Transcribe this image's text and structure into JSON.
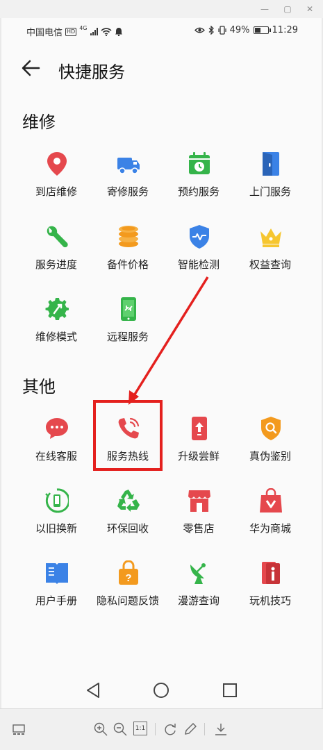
{
  "window": {
    "minimize_glyph": "—",
    "restore_glyph": "▢",
    "close_glyph": "✕"
  },
  "status_bar": {
    "carrier": "中国电信",
    "hd_badge": "HD",
    "network": "4G",
    "battery": "49%",
    "battery_level": 0.49,
    "time": "11:29"
  },
  "header": {
    "title": "快捷服务"
  },
  "sections": [
    {
      "title": "维修",
      "items": [
        {
          "label": "到店维修",
          "icon": "location-pin-icon"
        },
        {
          "label": "寄修服务",
          "icon": "truck-icon"
        },
        {
          "label": "预约服务",
          "icon": "calendar-clock-icon"
        },
        {
          "label": "上门服务",
          "icon": "door-icon"
        },
        {
          "label": "服务进度",
          "icon": "wrench-icon"
        },
        {
          "label": "备件价格",
          "icon": "coin-stack-icon"
        },
        {
          "label": "智能检测",
          "icon": "shield-pulse-icon"
        },
        {
          "label": "权益查询",
          "icon": "crown-icon"
        },
        {
          "label": "维修模式",
          "icon": "gear-wrench-icon"
        },
        {
          "label": "远程服务",
          "icon": "remote-phone-icon"
        }
      ]
    },
    {
      "title": "其他",
      "items": [
        {
          "label": "在线客服",
          "icon": "chat-bubble-icon"
        },
        {
          "label": "服务热线",
          "icon": "phone-hotline-icon"
        },
        {
          "label": "升级尝鲜",
          "icon": "upgrade-icon"
        },
        {
          "label": "真伪鉴别",
          "icon": "verify-search-icon"
        },
        {
          "label": "以旧换新",
          "icon": "trade-in-icon"
        },
        {
          "label": "环保回收",
          "icon": "recycle-icon"
        },
        {
          "label": "零售店",
          "icon": "store-icon"
        },
        {
          "label": "华为商城",
          "icon": "shopping-bag-icon"
        },
        {
          "label": "用户手册",
          "icon": "book-icon"
        },
        {
          "label": "隐私问题反馈",
          "icon": "privacy-lock-icon"
        },
        {
          "label": "漫游查询",
          "icon": "satellite-dish-icon"
        },
        {
          "label": "玩机技巧",
          "icon": "tips-info-icon"
        }
      ]
    }
  ],
  "navigation": {
    "back": "nav-back-icon",
    "home": "nav-home-icon",
    "recents": "nav-recents-icon"
  },
  "viewer_toolbar": {
    "fit_label": "1:1"
  },
  "colors": {
    "highlight": "#e4201e",
    "red": "#e5484d",
    "blue": "#3b82e6",
    "green": "#35b44a",
    "orange": "#f39a1e",
    "yellow": "#f6c62f"
  }
}
